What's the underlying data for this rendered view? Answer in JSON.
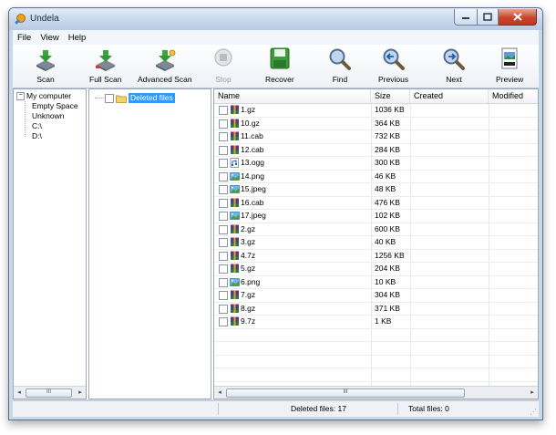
{
  "window": {
    "title": "Undela"
  },
  "menu": [
    "File",
    "View",
    "Help"
  ],
  "toolbar": [
    {
      "label": "Scan",
      "icon": "scan-icon",
      "enabled": true
    },
    {
      "label": "Full Scan",
      "icon": "full-scan-icon",
      "enabled": true
    },
    {
      "label": "Advanced Scan",
      "icon": "advanced-scan-icon",
      "enabled": true
    },
    {
      "label": "Stop",
      "icon": "stop-icon",
      "enabled": false
    },
    {
      "label": "Recover",
      "icon": "recover-icon",
      "enabled": true
    },
    {
      "label": "Find",
      "icon": "find-icon",
      "enabled": true
    },
    {
      "label": "Previous",
      "icon": "previous-icon",
      "enabled": true
    },
    {
      "label": "Next",
      "icon": "next-icon",
      "enabled": true
    },
    {
      "label": "Preview",
      "icon": "preview-icon",
      "enabled": true
    }
  ],
  "drive_tree": {
    "root": "My computer",
    "children": [
      "Empty Space",
      "Unknown",
      "C:\\",
      "D:\\"
    ]
  },
  "folder_tree": {
    "items": [
      "Deleted files"
    ]
  },
  "file_list": {
    "columns": [
      "Name",
      "Size",
      "Created",
      "Modified"
    ],
    "rows": [
      {
        "name": "1.gz",
        "size": "1036 KB",
        "type": "archive"
      },
      {
        "name": "10.gz",
        "size": "364 KB",
        "type": "archive"
      },
      {
        "name": "11.cab",
        "size": "732 KB",
        "type": "archive"
      },
      {
        "name": "12.cab",
        "size": "284 KB",
        "type": "archive"
      },
      {
        "name": "13.ogg",
        "size": "300 KB",
        "type": "audio"
      },
      {
        "name": "14.png",
        "size": "46 KB",
        "type": "image"
      },
      {
        "name": "15.jpeg",
        "size": "48 KB",
        "type": "image"
      },
      {
        "name": "16.cab",
        "size": "476 KB",
        "type": "archive"
      },
      {
        "name": "17.jpeg",
        "size": "102 KB",
        "type": "image"
      },
      {
        "name": "2.gz",
        "size": "600 KB",
        "type": "archive"
      },
      {
        "name": "3.gz",
        "size": "40 KB",
        "type": "archive"
      },
      {
        "name": "4.7z",
        "size": "1256 KB",
        "type": "archive"
      },
      {
        "name": "5.gz",
        "size": "204 KB",
        "type": "archive"
      },
      {
        "name": "6.png",
        "size": "10 KB",
        "type": "image"
      },
      {
        "name": "7.gz",
        "size": "304 KB",
        "type": "archive"
      },
      {
        "name": "8.gz",
        "size": "371 KB",
        "type": "archive"
      },
      {
        "name": "9.7z",
        "size": "1 KB",
        "type": "archive"
      }
    ]
  },
  "status": {
    "deleted_files": "Deleted files: 17",
    "total_files": "Total files: 0"
  },
  "scrollbar": {
    "thumb_glyph": "III"
  },
  "colors": {
    "selection": "#3399ff",
    "window_frame": "#c9d9ec"
  }
}
